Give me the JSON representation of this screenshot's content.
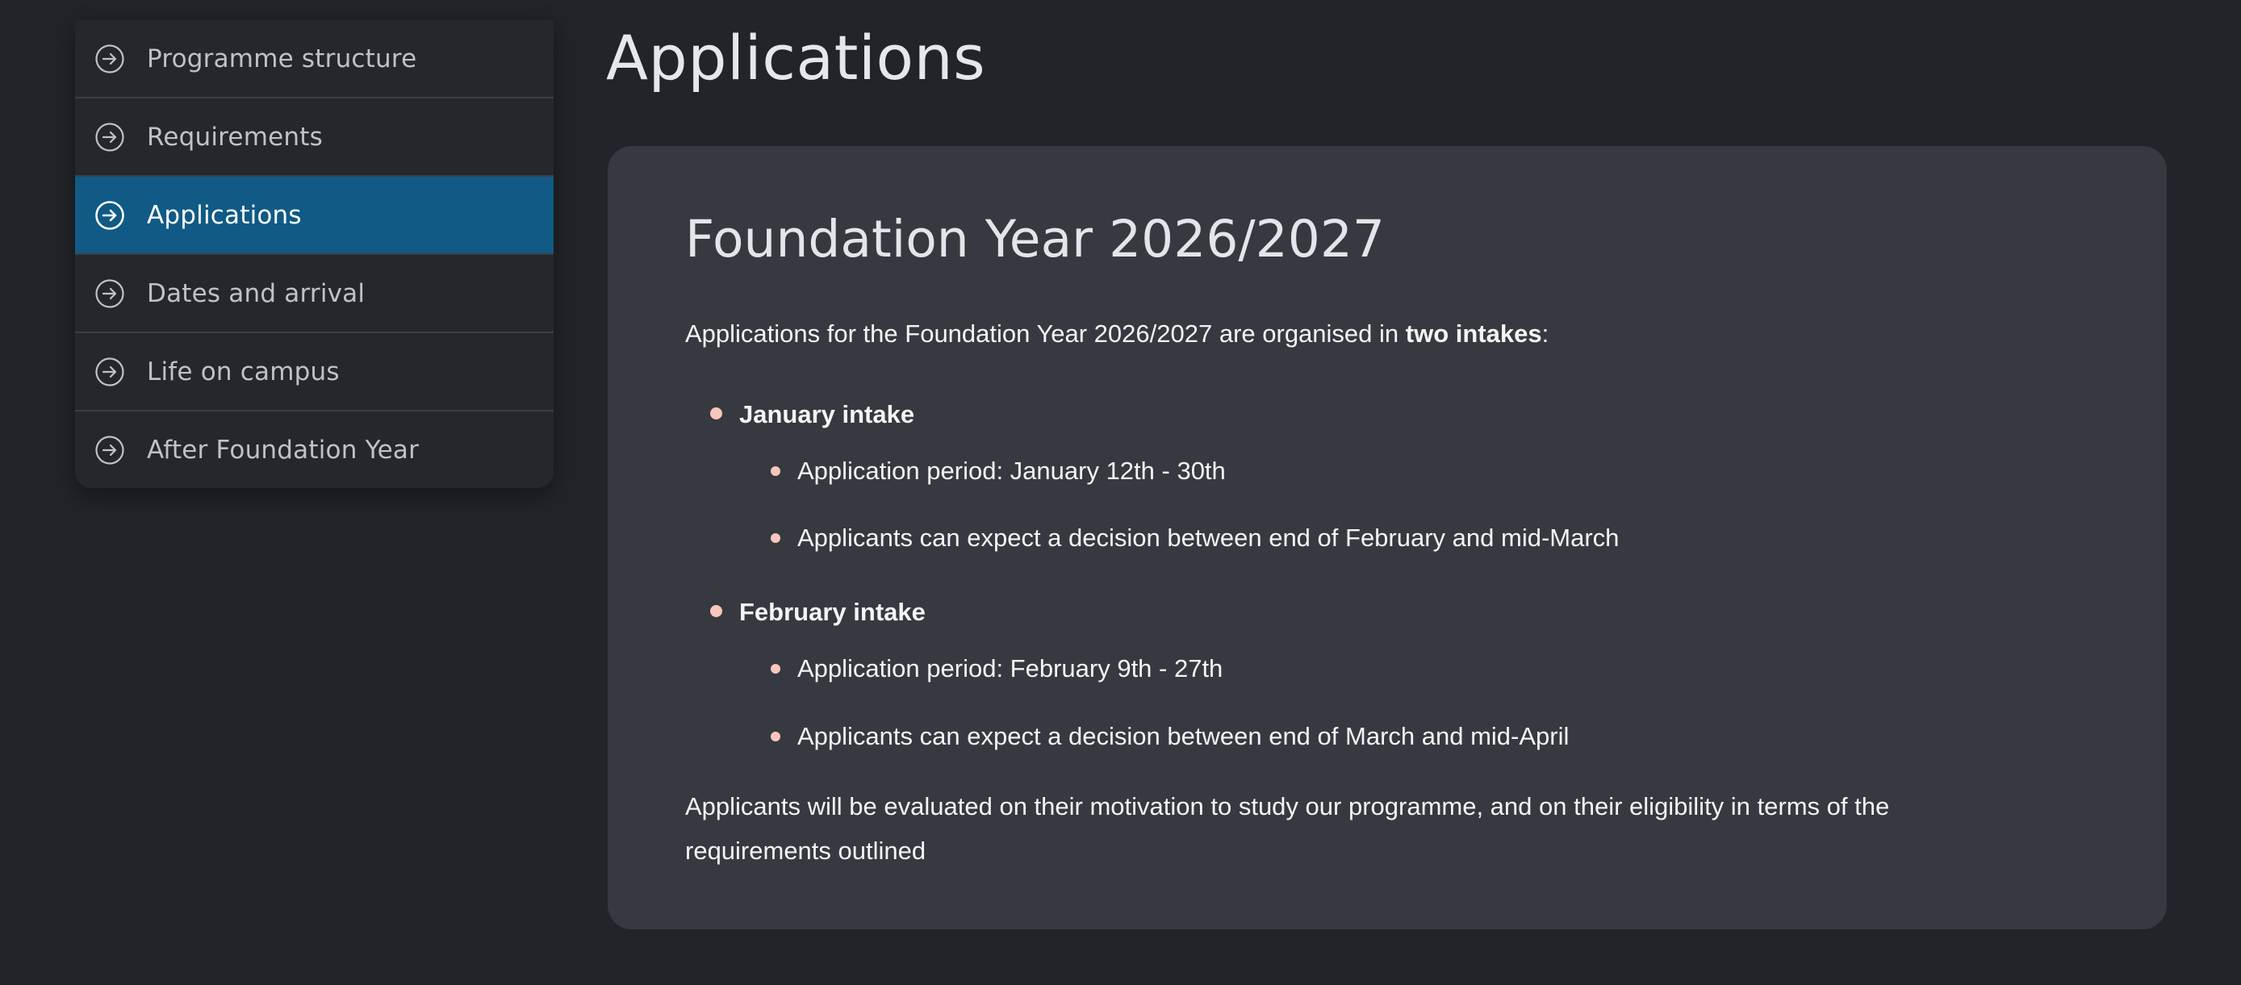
{
  "sidebar": {
    "items": [
      {
        "label": "Programme structure",
        "active": false
      },
      {
        "label": "Requirements",
        "active": false
      },
      {
        "label": "Applications",
        "active": true
      },
      {
        "label": "Dates and arrival",
        "active": false
      },
      {
        "label": "Life on campus",
        "active": false
      },
      {
        "label": "After Foundation Year",
        "active": false
      }
    ],
    "icon": "arrow-right-circle-icon",
    "active_color": "#105a85"
  },
  "main": {
    "title": "Applications",
    "card": {
      "heading": "Foundation Year 2026/2027",
      "intro_prefix": "Applications for the Foundation Year 2026/2027 are organised in ",
      "intro_bold": "two intakes",
      "intro_suffix": ":",
      "intakes": [
        {
          "name": "January intake",
          "details": [
            "Application period: January 12th - 30th",
            "Applicants can expect a decision between end of February and mid-March"
          ]
        },
        {
          "name": "February intake",
          "details": [
            "Application period: February 9th - 27th",
            "Applicants can expect a decision between end of March and mid-April"
          ]
        }
      ],
      "outro": "Applicants will be evaluated on their motivation to study our programme, and on their eligibility in terms of the requirements outlined"
    }
  },
  "colors": {
    "background": "#212428",
    "card": "#363940",
    "bullet": "#f8c6bd"
  }
}
